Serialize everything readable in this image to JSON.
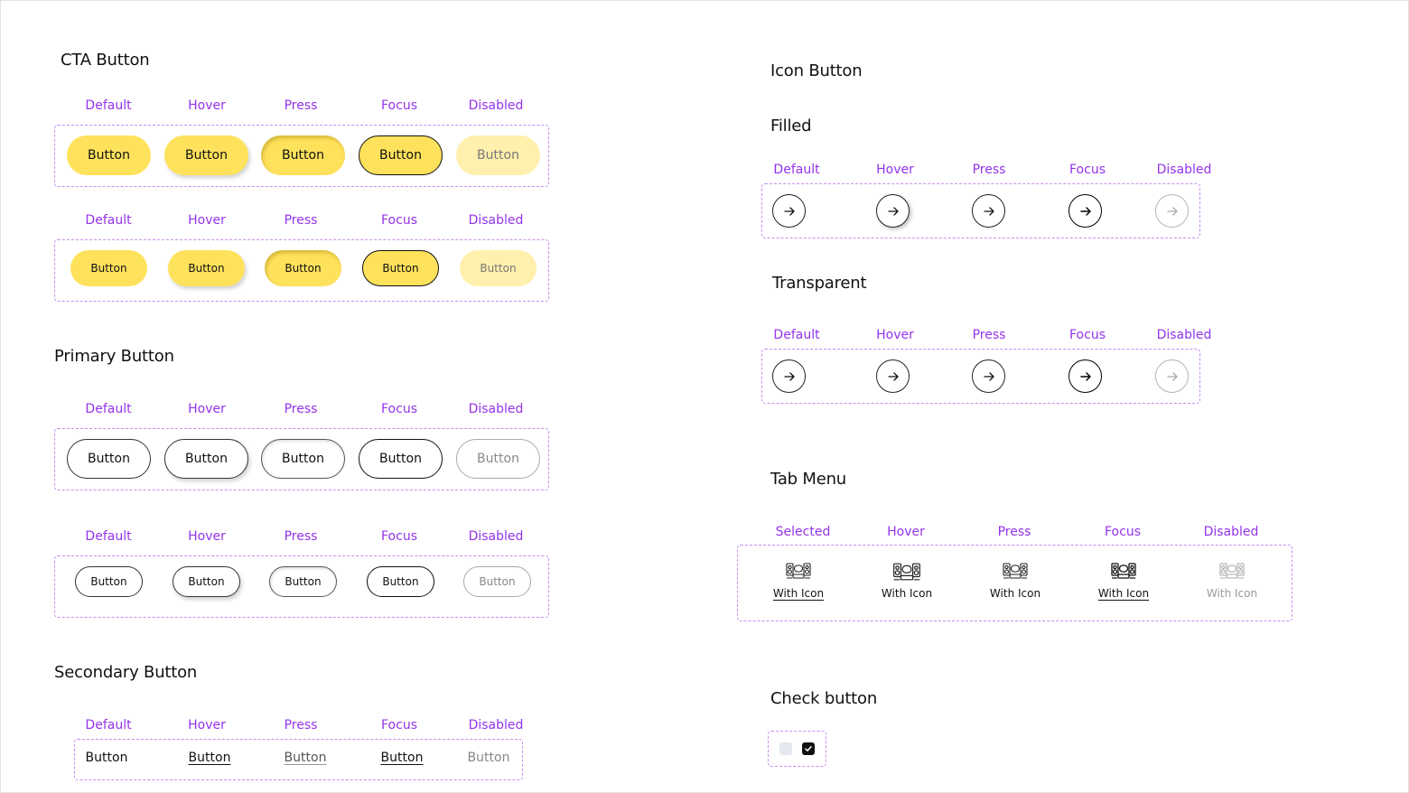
{
  "sections": {
    "cta": "CTA Button",
    "primary": "Primary Button",
    "secondary": "Secondary Button",
    "icon": "Icon Button",
    "filled": "Filled",
    "transparent": "Transparent",
    "tab": "Tab Menu",
    "check": "Check button"
  },
  "states": {
    "default": "Default",
    "hover": "Hover",
    "press": "Press",
    "focus": "Focus",
    "disabled": "Disabled",
    "selected": "Selected"
  },
  "button_label": "Button",
  "tab_label": "With Icon",
  "icons": {
    "arrow": "arrow-right-icon",
    "tab": "speakers-icon",
    "check": "checkmark-icon"
  },
  "colors": {
    "state_label": "#9333ea",
    "cta": "#ffe25c",
    "cta_disabled": "#fff0ad",
    "dashed_border": "#c48df0"
  }
}
